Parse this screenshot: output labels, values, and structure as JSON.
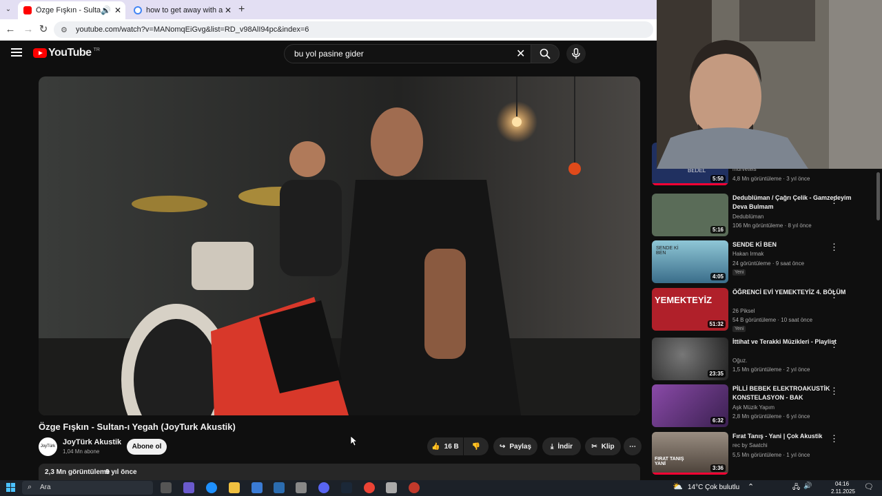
{
  "browser": {
    "tabs": [
      {
        "title": "Özge Fışkın - Sultan-ı Yegah",
        "active": true,
        "favicon_color": "#ff0000"
      },
      {
        "title": "how to get away with a murder",
        "active": false,
        "favicon_color": "#4285f4"
      }
    ],
    "new_tab": "+",
    "url": "youtube.com/watch?v=MANomqEiGvg&list=RD_v98AlI94pc&index=6"
  },
  "youtube": {
    "logo_text": "YouTube",
    "logo_country": "TR",
    "search_value": "bu yol pasine gider",
    "clear_icon": "✕",
    "video": {
      "title": "Özge Fışkın - Sultan-ı Yegah (JoyTurk Akustik)",
      "channel": "JoyTürk Akustik",
      "avatar_text": "JoyTürk",
      "subscribers": "1,04 Mn abone",
      "subscribe": "Abone ol",
      "likes": "16 B",
      "share": "Paylaş",
      "download": "İndir",
      "clip": "Klip",
      "views": "2,3 Mn görüntüleme",
      "age": "9 yıl önce"
    },
    "recommendations": [
      {
        "title": "",
        "channel": "murveteis",
        "meta": "4,8 Mn görüntüleme · 3 yıl önce",
        "duration": "5:50",
        "thumb_label": "BEDEL",
        "color": "#203060"
      },
      {
        "title": "Dedublüman / Çağrı Çelik - Gamzedeyim Deva Bulmam",
        "channel": "Dedublüman",
        "meta": "106 Mn görüntüleme · 8 yıl önce",
        "duration": "5:16",
        "color": "#5a6c58"
      },
      {
        "title": "SENDE Kİ BEN",
        "channel": "Hakan Irmak",
        "meta": "24 görüntüleme · 9 saat önce",
        "badge": "Yeni",
        "duration": "4:05",
        "thumb_label": "SENDE Kİ BEN",
        "color": "#8fc7d6"
      },
      {
        "title": "ÖĞRENCİ EVİ YEMEKTEYİZ 4. BÖLÜM",
        "channel": "26 Piksel",
        "meta": "54 B görüntüleme · 10 saat önce",
        "badge": "Yeni",
        "duration": "51:32",
        "thumb_label": "YEMEKTEYİZ",
        "color": "#b0202a"
      },
      {
        "title": "İttihat ve Terakki Müzikleri - Playlist",
        "channel": "Oğuz.",
        "meta": "1,5 Mn görüntüleme · 2 yıl önce",
        "duration": "23:35",
        "color": "#3a3a3a"
      },
      {
        "title": "PİLLİ BEBEK ELEKTROAKUSTİK KONSTELASYON - BAK",
        "channel": "Aşk Müzik Yapım",
        "meta": "2,8 Mn görüntüleme · 6 yıl önce",
        "duration": "6:32",
        "color": "#6a3a8a"
      },
      {
        "title": "Fırat Tanış - Yani | Çok Akustik",
        "channel": "rec by Saatchi",
        "meta": "5,5 Mn görüntüleme · 1 yıl önce",
        "duration": "3:36",
        "thumb_label": "FIRAT TANIŞ YANİ",
        "color": "#7a6e62"
      }
    ]
  },
  "taskbar": {
    "search": "Ara",
    "weather": "14°C  Çok bulutlu",
    "time": "04:16",
    "date": "2.11.2025"
  }
}
